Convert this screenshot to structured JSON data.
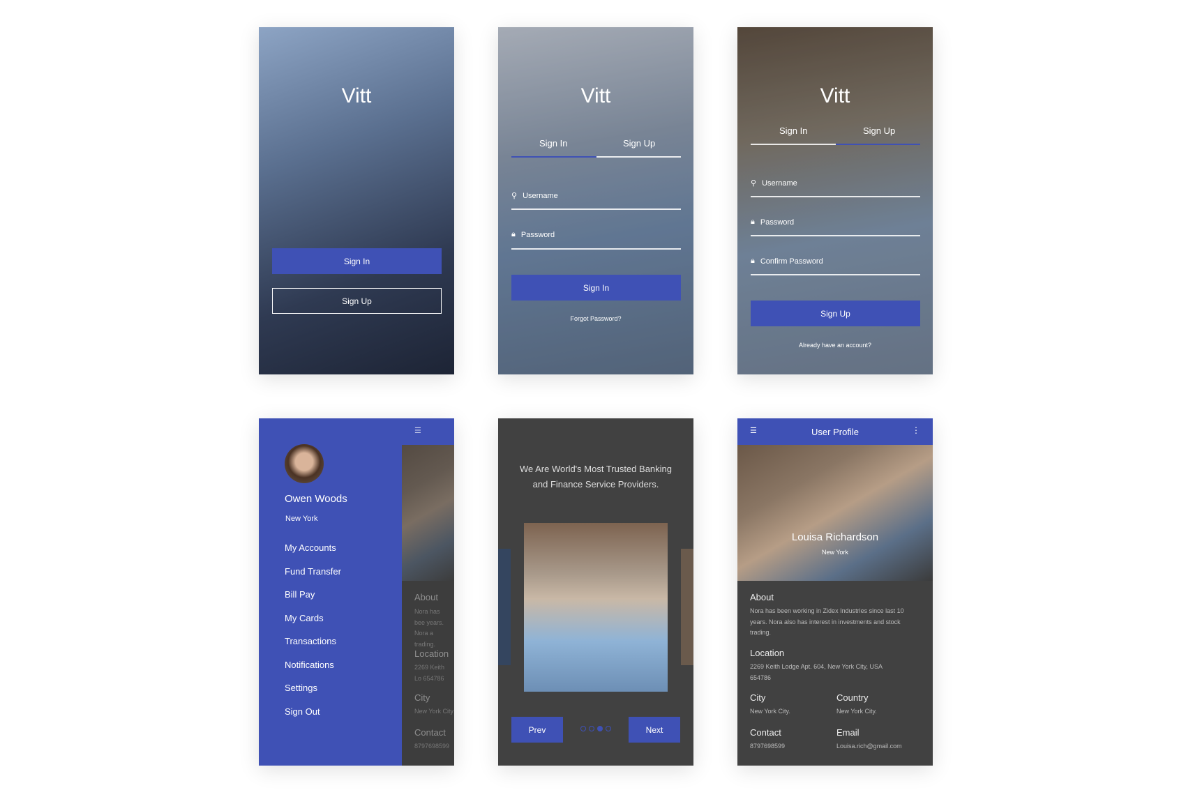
{
  "brand": "Vitt",
  "colors": {
    "accent": "#3f51b5",
    "dark_bg": "#414141"
  },
  "welcome": {
    "sign_in": "Sign In",
    "sign_up": "Sign Up"
  },
  "signin": {
    "tab_sign_in": "Sign In",
    "tab_sign_up": "Sign Up",
    "username": "Username",
    "password": "Password",
    "button": "Sign In",
    "forgot": "Forgot Password?"
  },
  "signup": {
    "tab_sign_in": "Sign In",
    "tab_sign_up": "Sign Up",
    "username": "Username",
    "password": "Password",
    "confirm": "Confirm Password",
    "button": "Sign Up",
    "already": "Already have an account?"
  },
  "drawer": {
    "name": "Owen Woods",
    "location": "New York",
    "menu": [
      "My Accounts",
      "Fund Transfer",
      "Bill Pay",
      "My Cards",
      "Transactions",
      "Notifications",
      "Settings",
      "Sign Out"
    ],
    "peek": {
      "about": "About",
      "about_text": "Nora has bee years. Nora a trading.",
      "location": "Location",
      "address": "2269 Keith Lo 654786",
      "city": "City",
      "city_val": "New York City",
      "contact": "Contact",
      "contact_val": "8797698599"
    }
  },
  "onboarding": {
    "headline1": "We Are World's Most Trusted Banking",
    "headline2": "and Finance Service Providers.",
    "prev": "Prev",
    "next": "Next",
    "page_count": 4,
    "active_page": 3
  },
  "profile": {
    "title": "User Profile",
    "name": "Louisa Richardson",
    "location": "New York",
    "about": "About",
    "about_text": "Nora has been working in Zidex Industries since last 10 years. Nora also has interest in investments and stock trading.",
    "location_label": "Location",
    "address": "2269 Keith Lodge Apt. 604, New York City, USA 654786",
    "city": "City",
    "city_val": "New York City.",
    "country": "Country",
    "country_val": "New York City.",
    "contact": "Contact",
    "contact_val": "8797698599",
    "email": "Email",
    "email_val": "Louisa.rich@gmail.com"
  }
}
